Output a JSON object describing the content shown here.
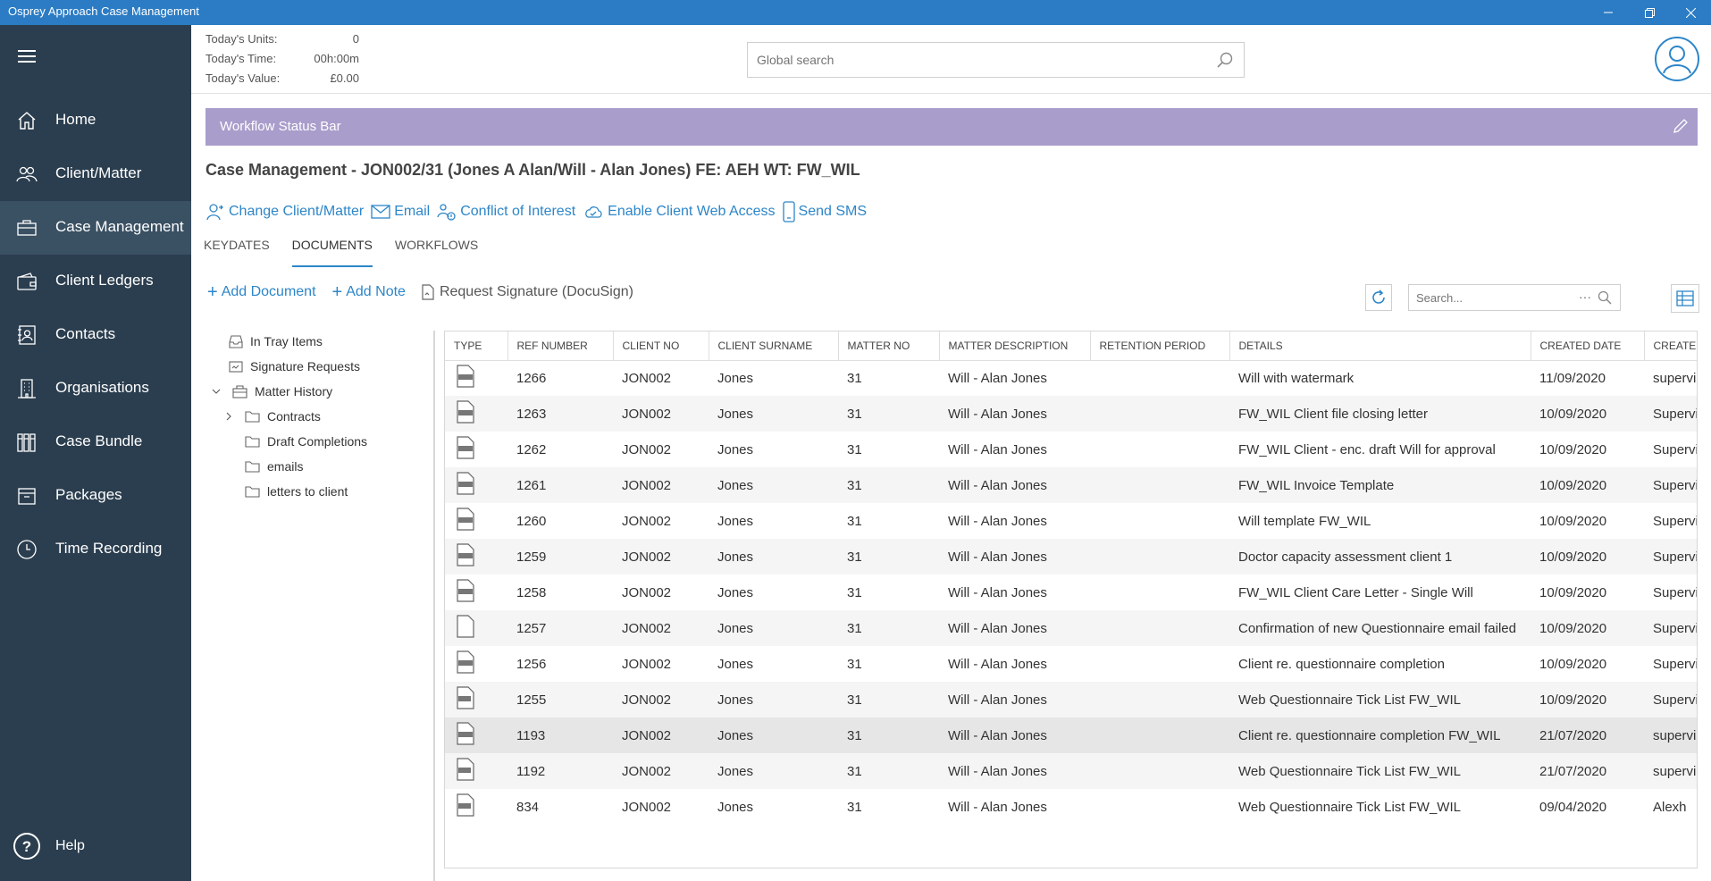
{
  "window": {
    "title": "Osprey Approach Case Management"
  },
  "nav": {
    "items": [
      {
        "label": "Home",
        "icon": "home-icon"
      },
      {
        "label": "Client/Matter",
        "icon": "people-icon"
      },
      {
        "label": "Case Management",
        "icon": "briefcase-icon",
        "active": true
      },
      {
        "label": "Client Ledgers",
        "icon": "wallet-icon"
      },
      {
        "label": "Contacts",
        "icon": "contacts-icon"
      },
      {
        "label": "Organisations",
        "icon": "building-icon"
      },
      {
        "label": "Case Bundle",
        "icon": "books-icon"
      },
      {
        "label": "Packages",
        "icon": "package-icon"
      },
      {
        "label": "Time Recording",
        "icon": "clock-icon"
      }
    ],
    "help_label": "Help"
  },
  "stats": {
    "units_label": "Today's Units:",
    "units_value": "0",
    "time_label": "Today's Time:",
    "time_value": "00h:00m",
    "value_label": "Today's Value:",
    "value_value": "£0.00"
  },
  "search": {
    "placeholder": "Global search"
  },
  "workflow_bar": {
    "label": "Workflow Status Bar",
    "color": "#a99dcb"
  },
  "case_title": "Case Management - JON002/31 (Jones A Alan/Will - Alan Jones) FE: AEH WT: FW_WIL",
  "actions": {
    "change_client": "Change Client/Matter",
    "email": "Email",
    "conflict": "Conflict of Interest",
    "web_access": "Enable Client Web Access",
    "sms": "Send SMS"
  },
  "tabs": {
    "keydates": "KEYDATES",
    "documents": "DOCUMENTS",
    "workflows": "WORKFLOWS"
  },
  "doc_toolbar": {
    "add_document": "Add Document",
    "add_note": "Add Note",
    "request_signature": "Request Signature (DocuSign)",
    "search_placeholder": "Search...",
    "more": "···"
  },
  "tree": {
    "in_tray": "In Tray Items",
    "signature_requests": "Signature Requests",
    "matter_history": "Matter History",
    "contracts": "Contracts",
    "draft_completions": "Draft Completions",
    "emails": "emails",
    "letters": "letters to client"
  },
  "grid": {
    "columns": [
      "TYPE",
      "REF NUMBER",
      "CLIENT NO",
      "CLIENT SURNAME",
      "MATTER NO",
      "MATTER DESCRIPTION",
      "RETENTION PERIOD",
      "DETAILS",
      "CREATED DATE",
      "CREATED"
    ],
    "rows": [
      {
        "type": "doc",
        "ref": "1266",
        "client_no": "JON002",
        "surname": "Jones",
        "matter_no": "31",
        "matter_desc": "Will - Alan Jones",
        "retention": "",
        "details": "Will with watermark",
        "created_date": "11/09/2020",
        "created_by": "supervis"
      },
      {
        "type": "docx",
        "ref": "1263",
        "client_no": "JON002",
        "surname": "Jones",
        "matter_no": "31",
        "matter_desc": "Will - Alan Jones",
        "retention": "",
        "details": "FW_WIL Client file closing letter",
        "created_date": "10/09/2020",
        "created_by": "Supervi"
      },
      {
        "type": "docx",
        "ref": "1262",
        "client_no": "JON002",
        "surname": "Jones",
        "matter_no": "31",
        "matter_desc": "Will - Alan Jones",
        "retention": "",
        "details": "FW_WIL Client - enc. draft Will for approval",
        "created_date": "10/09/2020",
        "created_by": "Supervi"
      },
      {
        "type": "docx",
        "ref": "1261",
        "client_no": "JON002",
        "surname": "Jones",
        "matter_no": "31",
        "matter_desc": "Will - Alan Jones",
        "retention": "",
        "details": "FW_WIL Invoice Template",
        "created_date": "10/09/2020",
        "created_by": "Supervi"
      },
      {
        "type": "docx",
        "ref": "1260",
        "client_no": "JON002",
        "surname": "Jones",
        "matter_no": "31",
        "matter_desc": "Will - Alan Jones",
        "retention": "",
        "details": "Will template FW_WIL",
        "created_date": "10/09/2020",
        "created_by": "Supervi"
      },
      {
        "type": "docx",
        "ref": "1259",
        "client_no": "JON002",
        "surname": "Jones",
        "matter_no": "31",
        "matter_desc": "Will - Alan Jones",
        "retention": "",
        "details": "Doctor capacity assessment client 1",
        "created_date": "10/09/2020",
        "created_by": "Supervi"
      },
      {
        "type": "docx",
        "ref": "1258",
        "client_no": "JON002",
        "surname": "Jones",
        "matter_no": "31",
        "matter_desc": "Will - Alan Jones",
        "retention": "",
        "details": "FW_WIL Client Care Letter - Single Will",
        "created_date": "10/09/2020",
        "created_by": "Supervi"
      },
      {
        "type": "blank",
        "ref": "1257",
        "client_no": "JON002",
        "surname": "Jones",
        "matter_no": "31",
        "matter_desc": "Will - Alan Jones",
        "retention": "",
        "details": "Confirmation of new Questionnaire email failed",
        "created_date": "10/09/2020",
        "created_by": "Supervi"
      },
      {
        "type": "docx",
        "ref": "1256",
        "client_no": "JON002",
        "surname": "Jones",
        "matter_no": "31",
        "matter_desc": "Will - Alan Jones",
        "retention": "",
        "details": "Client re. questionnaire completion",
        "created_date": "10/09/2020",
        "created_by": "Supervi"
      },
      {
        "type": "pdf",
        "ref": "1255",
        "client_no": "JON002",
        "surname": "Jones",
        "matter_no": "31",
        "matter_desc": "Will - Alan Jones",
        "retention": "",
        "details": "Web Questionnaire Tick List FW_WIL",
        "created_date": "10/09/2020",
        "created_by": "Supervi"
      },
      {
        "type": "docx",
        "ref": "1193",
        "client_no": "JON002",
        "surname": "Jones",
        "matter_no": "31",
        "matter_desc": "Will - Alan Jones",
        "retention": "",
        "details": "Client re. questionnaire completion FW_WIL",
        "created_date": "21/07/2020",
        "created_by": "supervis"
      },
      {
        "type": "pdf",
        "ref": "1192",
        "client_no": "JON002",
        "surname": "Jones",
        "matter_no": "31",
        "matter_desc": "Will - Alan Jones",
        "retention": "",
        "details": "Web Questionnaire Tick List FW_WIL",
        "created_date": "21/07/2020",
        "created_by": "supervis"
      },
      {
        "type": "pdf",
        "ref": "834",
        "client_no": "JON002",
        "surname": "Jones",
        "matter_no": "31",
        "matter_desc": "Will - Alan Jones",
        "retention": "",
        "details": "Web Questionnaire Tick List FW_WIL",
        "created_date": "09/04/2020",
        "created_by": "Alexh"
      }
    ]
  },
  "colors": {
    "titlebar": "#2b7cc4",
    "sidebar": "#2b3e4f",
    "accent": "#2d86c8"
  }
}
